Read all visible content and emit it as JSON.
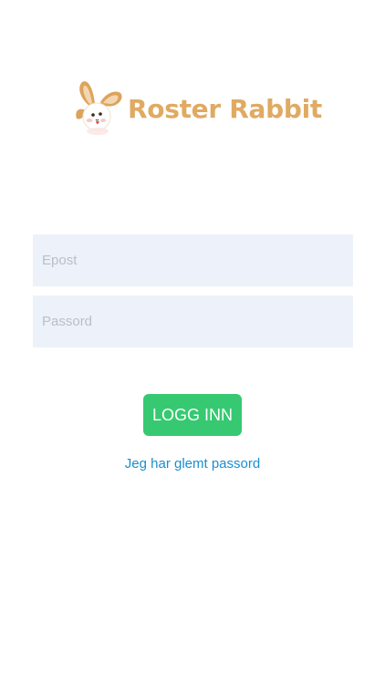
{
  "logo": {
    "icon": "rabbit-mascot-icon",
    "brand_name": "Roster Rabbit",
    "brand_color": "#e0aa62"
  },
  "login_form": {
    "email_placeholder": "Epost",
    "email_value": "",
    "password_placeholder": "Passord",
    "password_value": "",
    "field_background": "#edf1f9",
    "submit_label": "LOGG INN",
    "submit_color": "#36c971",
    "forgot_password_label": "Jeg har glemt passord",
    "link_color": "#1a8ed0"
  }
}
